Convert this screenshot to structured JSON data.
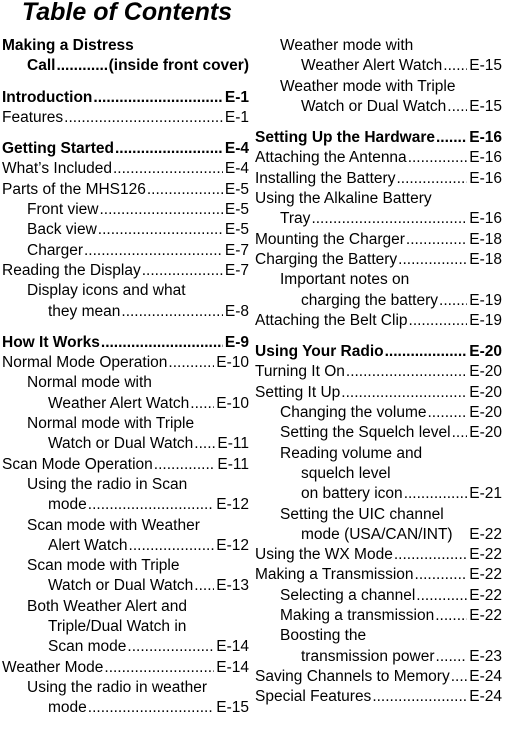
{
  "document": {
    "title": "Table of Contents"
  },
  "columns": {
    "left": [
      {
        "text": "Making a Distress",
        "page": "",
        "level": 0,
        "bold": true,
        "dots": false,
        "gap": false
      },
      {
        "text": "Call",
        "page": "(inside front cover)",
        "level": 1,
        "bold": true,
        "dots": true,
        "gap": false
      },
      {
        "text": "Introduction",
        "page": "E-1",
        "level": 0,
        "bold": true,
        "dots": true,
        "gap": true
      },
      {
        "text": "Features",
        "page": "E-1",
        "level": 0,
        "bold": false,
        "dots": true,
        "gap": false
      },
      {
        "text": "Getting Started",
        "page": "E-4",
        "level": 0,
        "bold": true,
        "dots": true,
        "gap": true
      },
      {
        "text": "What’s Included",
        "page": "E-4",
        "level": 0,
        "bold": false,
        "dots": true,
        "gap": false
      },
      {
        "text": "Parts of the MHS126",
        "page": "E-5",
        "level": 0,
        "bold": false,
        "dots": true,
        "gap": false
      },
      {
        "text": "Front view",
        "page": "E-5",
        "level": 1,
        "bold": false,
        "dots": true,
        "gap": false
      },
      {
        "text": "Back view",
        "page": "E-5",
        "level": 1,
        "bold": false,
        "dots": true,
        "gap": false
      },
      {
        "text": "Charger",
        "page": "E-7",
        "level": 1,
        "bold": false,
        "dots": true,
        "gap": false
      },
      {
        "text": "Reading the Display",
        "page": "E-7",
        "level": 0,
        "bold": false,
        "dots": true,
        "gap": false
      },
      {
        "text": "Display icons and what",
        "page": "",
        "level": 1,
        "bold": false,
        "dots": false,
        "gap": false
      },
      {
        "text": "they mean",
        "page": "E-8",
        "level": 2,
        "bold": false,
        "dots": true,
        "gap": false
      },
      {
        "text": "How It Works",
        "page": "E-9",
        "level": 0,
        "bold": true,
        "dots": true,
        "gap": true
      },
      {
        "text": "Normal Mode Operation",
        "page": "E-10",
        "level": 0,
        "bold": false,
        "dots": true,
        "gap": false
      },
      {
        "text": "Normal mode with",
        "page": "",
        "level": 1,
        "bold": false,
        "dots": false,
        "gap": false
      },
      {
        "text": "Weather Alert Watch",
        "page": "E-10",
        "level": 2,
        "bold": false,
        "dots": true,
        "gap": false
      },
      {
        "text": "Normal mode with Triple",
        "page": "",
        "level": 1,
        "bold": false,
        "dots": false,
        "gap": false
      },
      {
        "text": "Watch or Dual Watch",
        "page": "E-11",
        "level": 2,
        "bold": false,
        "dots": true,
        "gap": false
      },
      {
        "text": "Scan Mode Operation",
        "page": "E-11",
        "level": 0,
        "bold": false,
        "dots": true,
        "gap": false
      },
      {
        "text": "Using the radio in Scan",
        "page": "",
        "level": 1,
        "bold": false,
        "dots": false,
        "gap": false
      },
      {
        "text": "mode",
        "page": "E-12",
        "level": 2,
        "bold": false,
        "dots": true,
        "gap": false
      },
      {
        "text": "Scan mode with Weather",
        "page": "",
        "level": 1,
        "bold": false,
        "dots": false,
        "gap": false
      },
      {
        "text": "Alert Watch",
        "page": "E-12",
        "level": 2,
        "bold": false,
        "dots": true,
        "gap": false
      },
      {
        "text": "Scan mode with Triple",
        "page": "",
        "level": 1,
        "bold": false,
        "dots": false,
        "gap": false
      },
      {
        "text": "Watch or Dual Watch",
        "page": "E-13",
        "level": 2,
        "bold": false,
        "dots": true,
        "gap": false
      },
      {
        "text": "Both Weather Alert and",
        "page": "",
        "level": 1,
        "bold": false,
        "dots": false,
        "gap": false
      },
      {
        "text": "Triple/Dual Watch in",
        "page": "",
        "level": 2,
        "bold": false,
        "dots": false,
        "gap": false
      },
      {
        "text": "Scan mode",
        "page": "E-14",
        "level": 2,
        "bold": false,
        "dots": true,
        "gap": false
      },
      {
        "text": "Weather Mode",
        "page": "E-14",
        "level": 0,
        "bold": false,
        "dots": true,
        "gap": false
      },
      {
        "text": "Using the radio in weather",
        "page": "",
        "level": 1,
        "bold": false,
        "dots": false,
        "gap": false
      },
      {
        "text": "mode",
        "page": "E-15",
        "level": 2,
        "bold": false,
        "dots": true,
        "gap": false
      }
    ],
    "right": [
      {
        "text": "Weather mode with",
        "page": "",
        "level": 1,
        "bold": false,
        "dots": false,
        "gap": false
      },
      {
        "text": "Weather Alert Watch",
        "page": "E-15",
        "level": 2,
        "bold": false,
        "dots": true,
        "gap": false
      },
      {
        "text": "Weather mode with Triple",
        "page": "",
        "level": 1,
        "bold": false,
        "dots": false,
        "gap": false
      },
      {
        "text": "Watch or Dual Watch",
        "page": "E-15",
        "level": 2,
        "bold": false,
        "dots": true,
        "gap": false
      },
      {
        "text": "Setting Up the Hardware",
        "page": "E-16",
        "level": 0,
        "bold": true,
        "dots": true,
        "gap": true
      },
      {
        "text": "Attaching the Antenna",
        "page": "E-16",
        "level": 0,
        "bold": false,
        "dots": true,
        "gap": false
      },
      {
        "text": "Installing the Battery",
        "page": "E-16",
        "level": 0,
        "bold": false,
        "dots": true,
        "gap": false
      },
      {
        "text": "Using the Alkaline Battery",
        "page": "",
        "level": 0,
        "bold": false,
        "dots": false,
        "gap": false
      },
      {
        "text": "Tray",
        "page": "E-16",
        "level": 1,
        "bold": false,
        "dots": true,
        "gap": false
      },
      {
        "text": "Mounting the Charger",
        "page": "E-18",
        "level": 0,
        "bold": false,
        "dots": true,
        "gap": false
      },
      {
        "text": "Charging the Battery",
        "page": "E-18",
        "level": 0,
        "bold": false,
        "dots": true,
        "gap": false
      },
      {
        "text": "Important notes on",
        "page": "",
        "level": 1,
        "bold": false,
        "dots": false,
        "gap": false
      },
      {
        "text": "charging the battery",
        "page": "E-19",
        "level": 2,
        "bold": false,
        "dots": true,
        "gap": false
      },
      {
        "text": "Attaching the Belt Clip",
        "page": "E-19",
        "level": 0,
        "bold": false,
        "dots": true,
        "gap": false
      },
      {
        "text": "Using Your Radio",
        "page": "E-20",
        "level": 0,
        "bold": true,
        "dots": true,
        "gap": true
      },
      {
        "text": "Turning It On",
        "page": "E-20",
        "level": 0,
        "bold": false,
        "dots": true,
        "gap": false
      },
      {
        "text": "Setting It Up",
        "page": "E-20",
        "level": 0,
        "bold": false,
        "dots": true,
        "gap": false
      },
      {
        "text": "Changing the volume",
        "page": "E-20",
        "level": 1,
        "bold": false,
        "dots": true,
        "gap": false
      },
      {
        "text": "Setting the Squelch level",
        "page": "E-20",
        "level": 1,
        "bold": false,
        "dots": true,
        "gap": false
      },
      {
        "text": "Reading volume and",
        "page": "",
        "level": 1,
        "bold": false,
        "dots": false,
        "gap": false
      },
      {
        "text": "squelch level",
        "page": "",
        "level": 2,
        "bold": false,
        "dots": false,
        "gap": false
      },
      {
        "text": "on battery icon",
        "page": "E-21",
        "level": 2,
        "bold": false,
        "dots": true,
        "gap": false
      },
      {
        "text": "Setting the UIC channel",
        "page": "",
        "level": 1,
        "bold": false,
        "dots": false,
        "gap": false
      },
      {
        "text": "mode (USA/CAN/INT)",
        "page": "E-22",
        "level": 2,
        "bold": false,
        "dots": false,
        "gap": false
      },
      {
        "text": "Using the WX Mode",
        "page": "E-22",
        "level": 0,
        "bold": false,
        "dots": true,
        "gap": false
      },
      {
        "text": "Making a Transmission",
        "page": "E-22",
        "level": 0,
        "bold": false,
        "dots": true,
        "gap": false
      },
      {
        "text": "Selecting a channel",
        "page": "E-22",
        "level": 1,
        "bold": false,
        "dots": true,
        "gap": false
      },
      {
        "text": "Making a transmission",
        "page": "E-22",
        "level": 1,
        "bold": false,
        "dots": true,
        "gap": false
      },
      {
        "text": "Boosting the",
        "page": "",
        "level": 1,
        "bold": false,
        "dots": false,
        "gap": false
      },
      {
        "text": "transmission power",
        "page": "E-23",
        "level": 2,
        "bold": false,
        "dots": true,
        "gap": false
      },
      {
        "text": "Saving Channels to Memory",
        "page": "E-24",
        "level": 0,
        "bold": false,
        "dots": true,
        "gap": false
      },
      {
        "text": "Special Features",
        "page": "E-24",
        "level": 0,
        "bold": false,
        "dots": true,
        "gap": false
      }
    ]
  }
}
